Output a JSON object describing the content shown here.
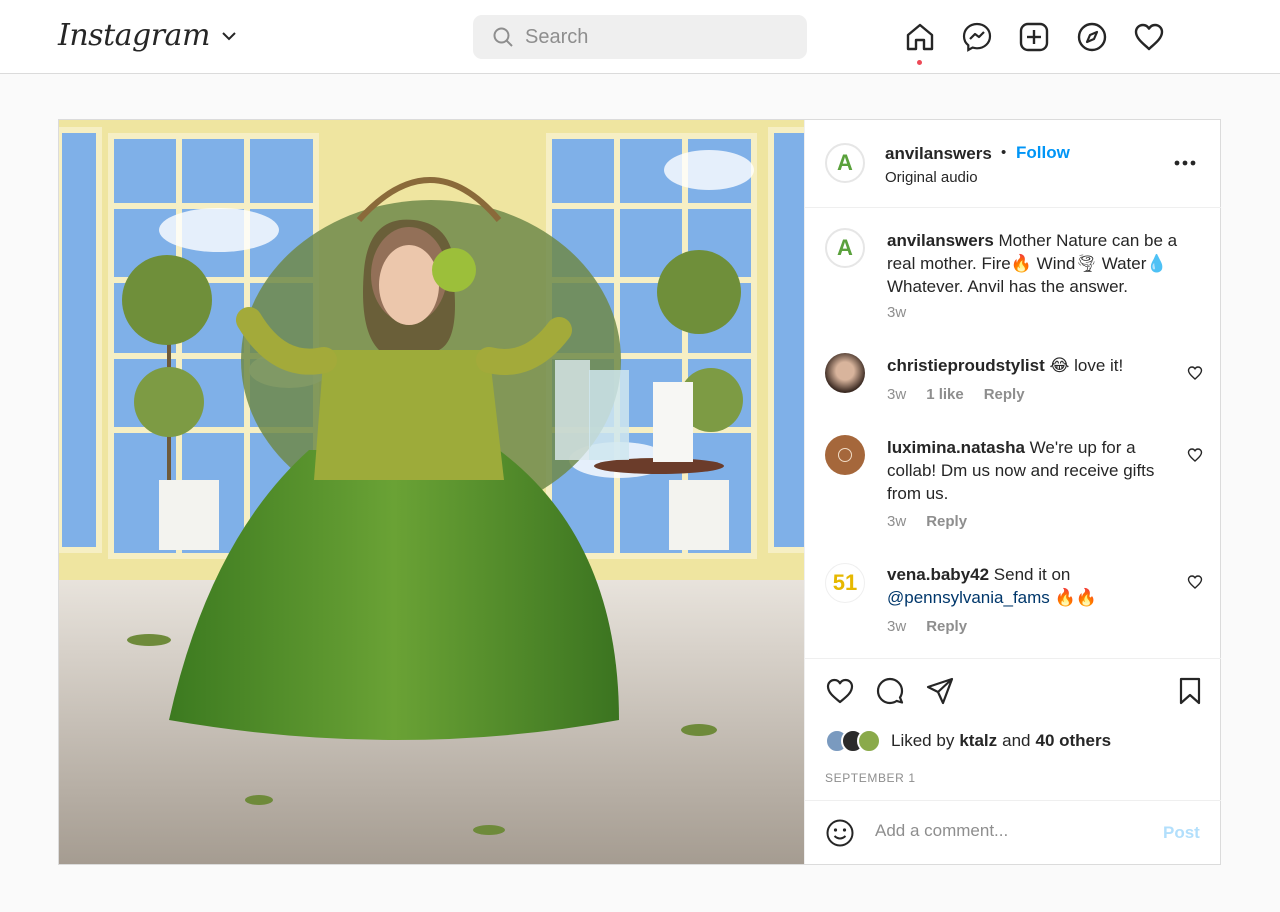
{
  "nav": {
    "logo": "Instagram",
    "search_placeholder": "Search",
    "icons": [
      "home-icon",
      "messenger-icon",
      "new-post-icon",
      "explore-icon",
      "activity-heart-icon"
    ],
    "notification_dot_color": "#ed4956"
  },
  "post": {
    "author": "anvilanswers",
    "dot": "•",
    "follow_label": "Follow",
    "audio": "Original audio",
    "more_icon": "more-options-icon",
    "caption": {
      "user": "anvilanswers",
      "text": "Mother Nature can be a real mother. Fire🔥 Wind🌪 Water💧 Whatever. Anvil has the answer.",
      "time": "3w"
    },
    "comments": [
      {
        "user": "christieproudstylist",
        "text": "😂 love it!",
        "time": "3w",
        "likes": "1 like",
        "reply": "Reply"
      },
      {
        "user": "luximina.natasha",
        "text": "We're up for a collab! Dm us now and receive gifts from us.",
        "time": "3w",
        "reply": "Reply"
      },
      {
        "user": "vena.baby42",
        "text": "Send it on",
        "mention": "@pennsylvania_fams",
        "emoji": "🔥🔥",
        "time": "3w",
        "reply": "Reply"
      }
    ],
    "liked_by_prefix": "Liked by",
    "liked_by_user": "ktalz",
    "liked_by_and": "and",
    "liked_by_count": "40 others",
    "date": "SEPTEMBER 1",
    "add_comment_placeholder": "Add a comment...",
    "post_label": "Post",
    "avatar_51": "51",
    "brand_letter": "A"
  },
  "colors": {
    "accent": "#0095f6",
    "post_disabled": "#b2dffc",
    "brand_green": "#5aa13c"
  }
}
